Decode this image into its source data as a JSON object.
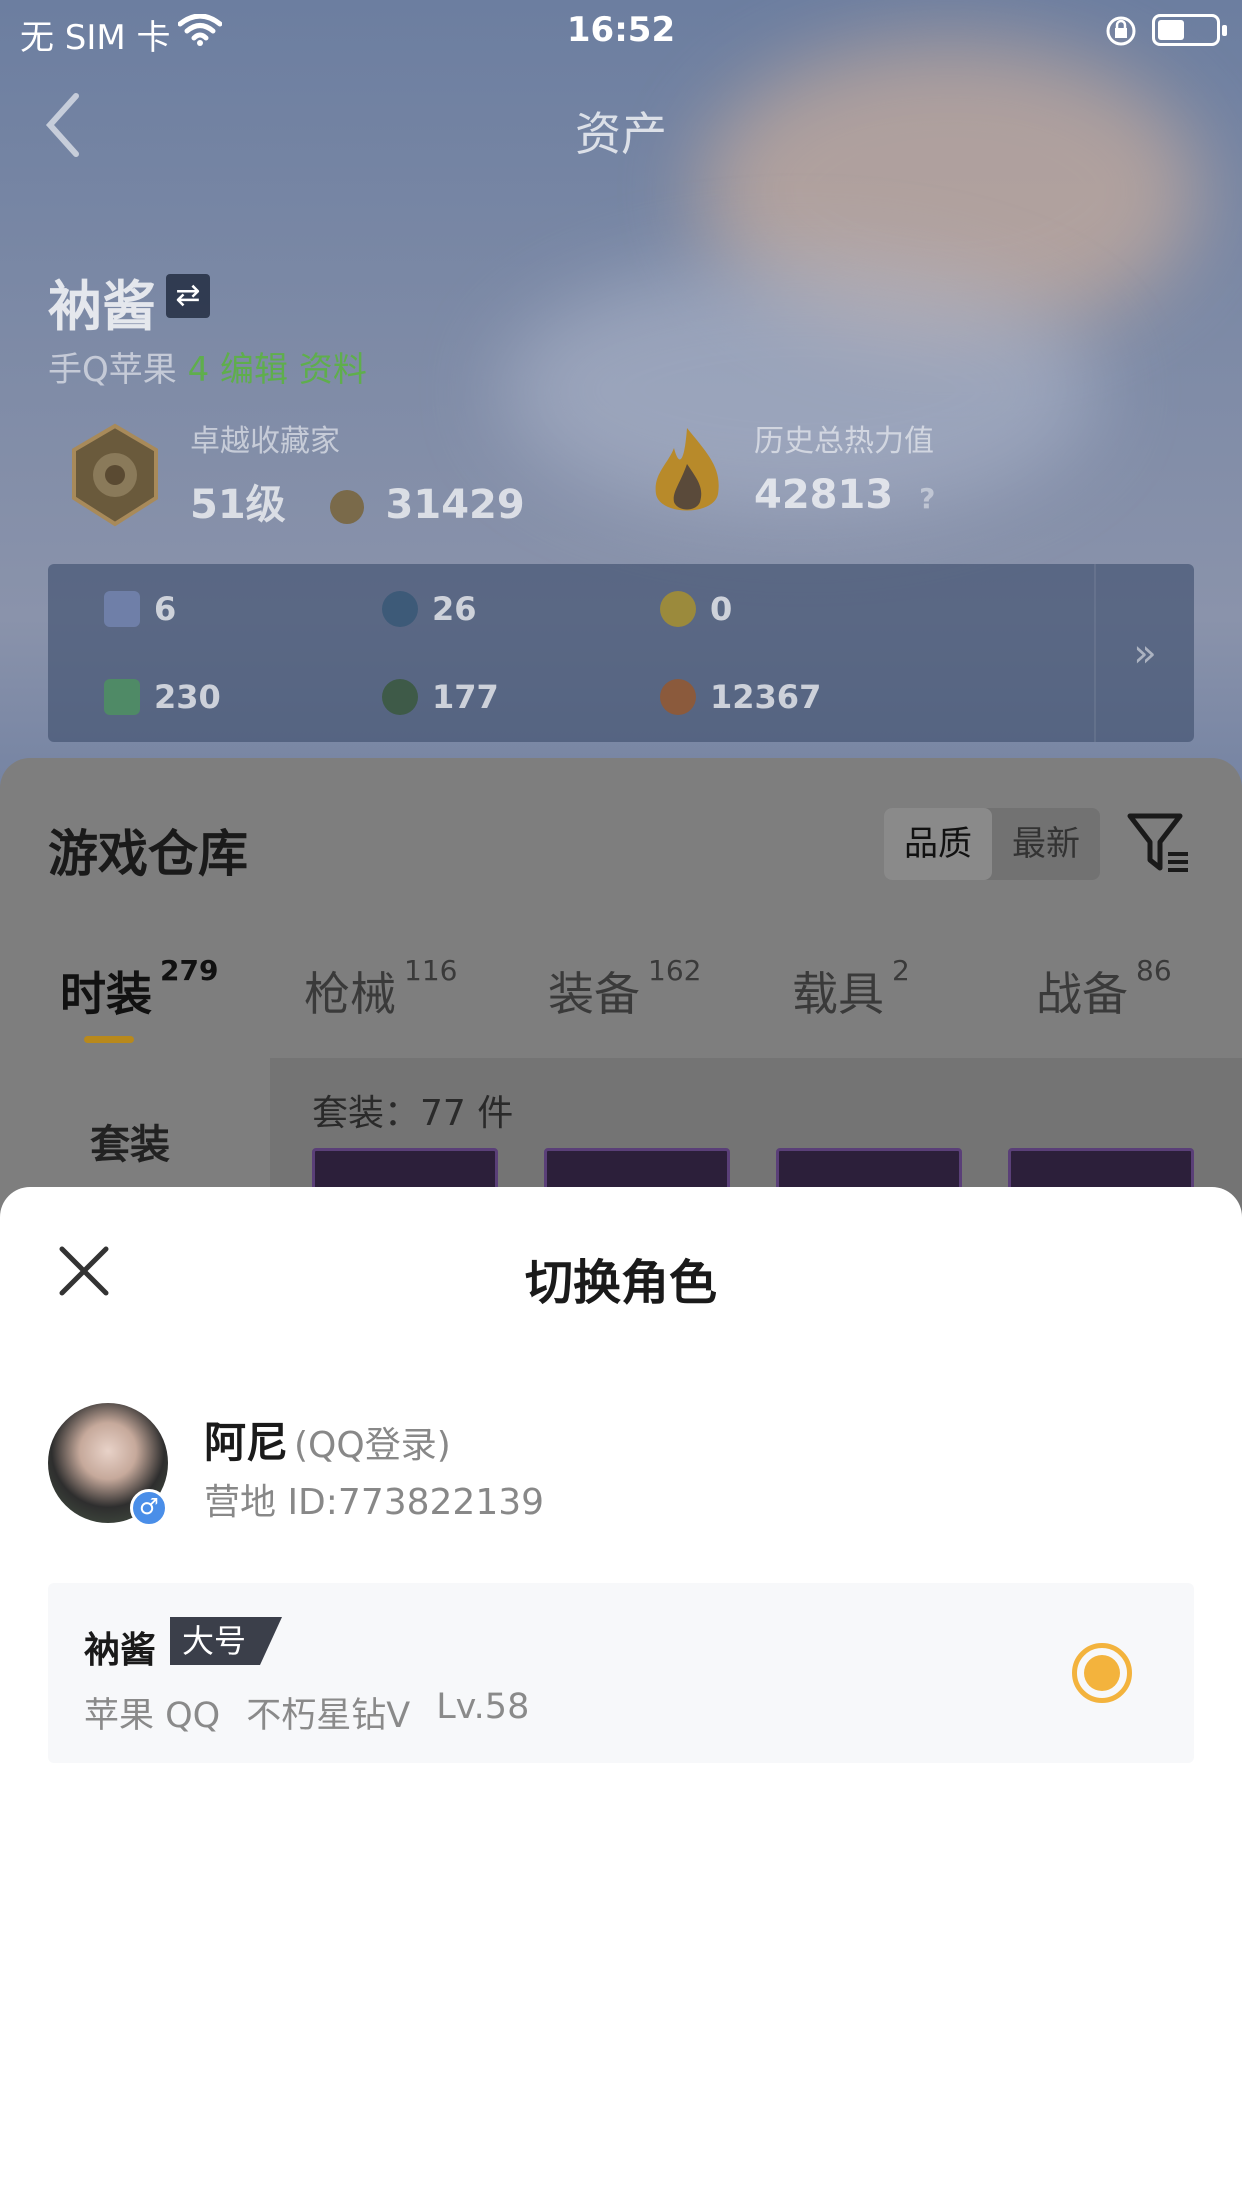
{
  "status_bar": {
    "carrier": "无 SIM 卡",
    "time": "16:52"
  },
  "header": {
    "title": "资产"
  },
  "player": {
    "name": "衲酱",
    "platform": "手Q苹果",
    "platform_extra": "4 编辑 资料",
    "collector_label": "卓越收藏家",
    "collector_level": "51级",
    "collector_points": "31429",
    "heat_label": "历史总热力值",
    "heat_value": "42813",
    "heat_help": "?"
  },
  "resources": [
    {
      "value": "6",
      "color": "#6f7fa8"
    },
    {
      "value": "26",
      "color": "#3d5a78"
    },
    {
      "value": "0",
      "color": "#9b8a3c"
    },
    {
      "value": "230",
      "color": "#4f8a66"
    },
    {
      "value": "177",
      "color": "#3e5a48"
    },
    {
      "value": "12367",
      "color": "#8b5a3c"
    }
  ],
  "resources_more": "»",
  "warehouse": {
    "title": "游戏仓库",
    "sort_quality": "品质",
    "sort_newest": "最新",
    "tabs": [
      {
        "label": "时装",
        "count": "279"
      },
      {
        "label": "枪械",
        "count": "116"
      },
      {
        "label": "装备",
        "count": "162"
      },
      {
        "label": "载具",
        "count": "2"
      },
      {
        "label": "战备",
        "count": "86"
      }
    ],
    "category": "套装",
    "set_count": "套装：77 件"
  },
  "sheet": {
    "title": "切换角色",
    "user_name": "阿尼",
    "login_type": "(QQ登录)",
    "camp_id": "营地 ID:773822139",
    "gender_symbol": "♂",
    "role": {
      "name": "衲酱",
      "tag": "大号",
      "platform": "苹果 QQ",
      "rank": "不朽星钻Ⅴ",
      "level": "Lv.58"
    },
    "accent_color": "#f3b33d"
  }
}
